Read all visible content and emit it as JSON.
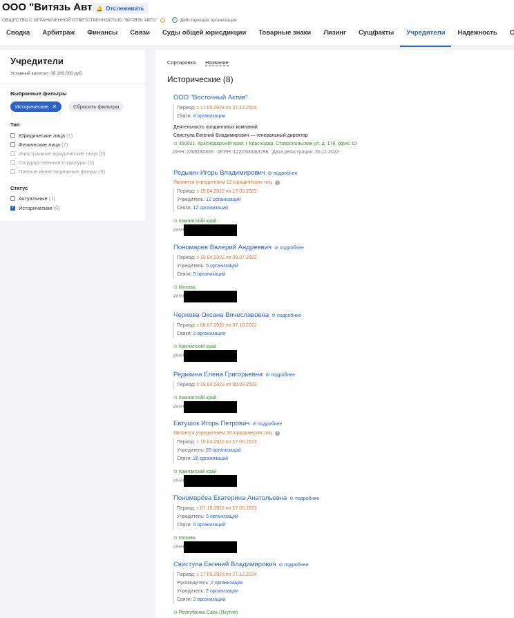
{
  "header": {
    "company": "ООО \"Витязь Авто\"",
    "follow_label": "Отслеживать",
    "full_name": "ОБЩЕСТВО С ОГРАНИЧЕННОЙ ОТВЕТСТВЕННОСТЬЮ \"ВИТЯЗЬ АВТО\"",
    "status": "Действующая организация"
  },
  "tabs": [
    "Сводка",
    "Арбитраж",
    "Финансы",
    "Связи",
    "Суды общей юрисдикции",
    "Товарные знаки",
    "Лизинг",
    "Сущфакты",
    "Учредители",
    "Надежность",
    "Санкции"
  ],
  "active_tab": "Учредители",
  "sidebar": {
    "title": "Учредители",
    "capital": "Уставный капитал: 35 260 000 руб.",
    "filters_heading": "Выбранные фильтры",
    "active_filter": "Исторические",
    "reset_label": "Сбросить фильтры",
    "type_heading": "Тип",
    "types": [
      {
        "label": "Юридические лица",
        "count": "(1)",
        "disabled": false
      },
      {
        "label": "Физические лица",
        "count": "(7)",
        "disabled": false
      },
      {
        "label": "Иностранные юридические лица",
        "count": "(0)",
        "disabled": true
      },
      {
        "label": "Государственные структуры",
        "count": "(0)",
        "disabled": true
      },
      {
        "label": "Паевые инвестиционные фонды",
        "count": "(0)",
        "disabled": true
      }
    ],
    "status_heading": "Статус",
    "statuses": [
      {
        "label": "Актуальные",
        "count": "(1)",
        "checked": false
      },
      {
        "label": "Исторические",
        "count": "(8)",
        "checked": true
      }
    ]
  },
  "main": {
    "sort_label": "Сортировка",
    "sort_value": "Название",
    "section_title": "Исторические (8)"
  },
  "entries": [
    {
      "name": "ООО \"Восточный Актив\"",
      "period_label": "Период:",
      "period": "с 17.05.2023 по 27.12.2024",
      "links_label": "Связи:",
      "links": "4 организации",
      "activity": "Деятельность холдинговых компаний",
      "director": "Свистула Евгений Владимирович — генеральный директор",
      "address": "350001, Краснодарский край, г Краснодар, Ставропольская ул, д. 178, офис 10",
      "inn": "ИНН: 2309180835",
      "ogrn": "ОГРН: 1222300063798",
      "reg": "Дата регистрации: 30.11.2022"
    },
    {
      "name": "Редькин Игорь Владимирович",
      "more": "подробнее",
      "founder_note": "Является учредителем 12 юридических лиц",
      "period_label": "Период:",
      "period": "с 19.04.2022 по 17.05.2023",
      "founder_label": "Учредитель:",
      "founder": "12 организаций",
      "links_label": "Связи:",
      "links": "12 организаций",
      "region": "Камчатский край",
      "inn_label": "ИНН"
    },
    {
      "name": "Пономарев Валерий Андреевич",
      "more": "подробнее",
      "period_label": "Период:",
      "period": "с 19.04.2022 по 08.07.2022",
      "founder_label": "Учредитель:",
      "founder": "5 организаций",
      "links_label": "Связи:",
      "links": "5 организаций",
      "region": "Москва",
      "inn_label": "ИНН"
    },
    {
      "name": "Чернова Оксана Вячеславовна",
      "more": "подробнее",
      "period_label": "Период:",
      "period": "с 08.07.2022 по 07.10.2022",
      "links_label": "Связи:",
      "links": "2 организации",
      "region": "Камчатский край",
      "inn_label": "ИНН"
    },
    {
      "name": "Редькина Елена Григорьевна",
      "more": "подробнее",
      "period_label": "Период:",
      "period": "с 19.04.2022 по 30.03.2023",
      "region": "Камчатский край",
      "inn_label": "ИНН"
    },
    {
      "name": "Евтушок Игорь Петрович",
      "more": "подробнее",
      "founder_note": "Является учредителем 20 юридических лиц",
      "period_label": "Период:",
      "period": "с 19.04.2022 по 17.05.2023",
      "founder_label": "Учредитель:",
      "founder": "20 организаций",
      "links_label": "Связи:",
      "links": "20 организаций",
      "region": "Камчатский край",
      "inn_label": "ИНН"
    },
    {
      "name": "Пономарёва Екатерина Анатольевна",
      "more": "подробнее",
      "period_label": "Период:",
      "period": "с 07.10.2022 по 17.05.2023",
      "founder_label": "Учредитель:",
      "founder": "5 организаций",
      "links_label": "Связи:",
      "links": "5 организаций",
      "region": "Москва",
      "inn_label": "ИНН"
    },
    {
      "name": "Свистула Евгений Владимирович",
      "more": "подробнее",
      "period_label": "Период:",
      "period": "с 17.05.2023 по 27.12.2024",
      "head_label": "Руководитель:",
      "head": "2 организации",
      "founder_label": "Учредитель:",
      "founder": "2 организации",
      "links_label": "Связи:",
      "links": "2 организации",
      "region": "Республика Саха (Якутия)"
    }
  ]
}
